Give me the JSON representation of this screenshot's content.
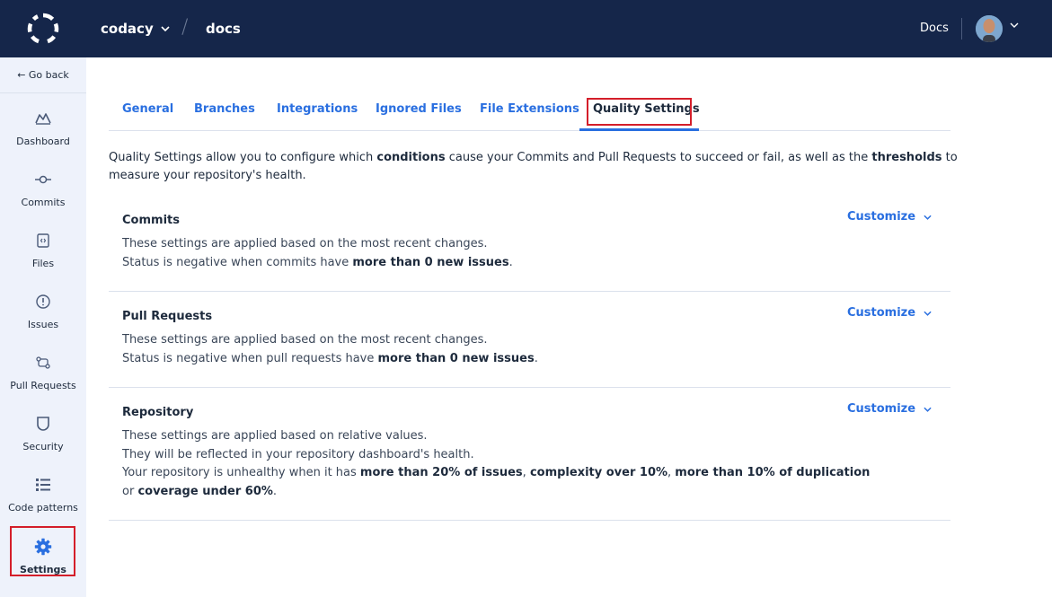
{
  "header": {
    "org_name": "codacy",
    "separator": "/",
    "repo_name": "docs",
    "docs_link": "Docs"
  },
  "sidebar": {
    "go_back": "← Go back",
    "items": [
      {
        "label": "Dashboard",
        "icon": "dashboard-icon"
      },
      {
        "label": "Commits",
        "icon": "commit-icon"
      },
      {
        "label": "Files",
        "icon": "file-icon"
      },
      {
        "label": "Issues",
        "icon": "issue-icon"
      },
      {
        "label": "Pull Requests",
        "icon": "pull-request-icon"
      },
      {
        "label": "Security",
        "icon": "shield-icon"
      },
      {
        "label": "Code patterns",
        "icon": "list-icon"
      },
      {
        "label": "Settings",
        "icon": "gear-icon",
        "active": true
      }
    ]
  },
  "tabs": [
    {
      "label": "General"
    },
    {
      "label": "Branches"
    },
    {
      "label": "Integrations"
    },
    {
      "label": "Ignored Files"
    },
    {
      "label": "File Extensions"
    },
    {
      "label": "Quality Settings",
      "active": true
    }
  ],
  "intro": {
    "part1": "Quality Settings allow you to configure which ",
    "bold1": "conditions",
    "part2": " cause your Commits and Pull Requests to succeed or fail, as well as the ",
    "bold2": "thresholds",
    "part3": " to measure your repository's health."
  },
  "sections": {
    "commits": {
      "title": "Commits",
      "line1": "These settings are applied based on the most recent changes.",
      "line2_prefix": "Status is negative when commits have ",
      "line2_bold": "more than 0 new issues",
      "line2_suffix": ".",
      "customize": "Customize"
    },
    "pull_requests": {
      "title": "Pull Requests",
      "line1": "These settings are applied based on the most recent changes.",
      "line2_prefix": "Status is negative when pull requests have ",
      "line2_bold": "more than 0 new issues",
      "line2_suffix": ".",
      "customize": "Customize"
    },
    "repository": {
      "title": "Repository",
      "line1": "These settings are applied based on relative values.",
      "line2": "They will be reflected in your repository dashboard's health.",
      "line3_prefix": "Your repository is unhealthy when it has ",
      "line3_b1": "more than 20% of issues",
      "line3_sep1": ", ",
      "line3_b2": "complexity over 10%",
      "line3_sep2": ", ",
      "line3_b3": "more than 10% of duplication",
      "line4_prefix": "or ",
      "line4_bold": "coverage under 60%",
      "line4_suffix": ".",
      "customize": "Customize"
    }
  },
  "colors": {
    "topbar": "#15264a",
    "accent": "#2a6fe0",
    "sidebar_bg": "#eef2fb",
    "highlight": "#d41e2a"
  }
}
